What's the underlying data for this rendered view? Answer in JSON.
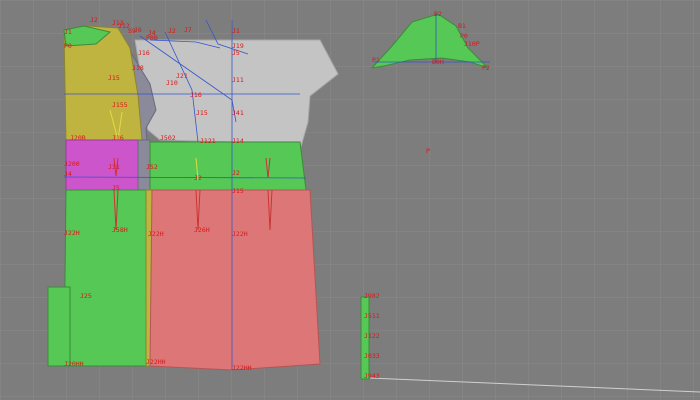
{
  "workspace": {
    "background": "#7d7d7d",
    "grid_color": "#8b8b8b"
  },
  "colors": {
    "green": "#55c855",
    "yellow": "#c0b440",
    "magenta": "#cc55cc",
    "salmon": "#dd7777",
    "light_gray": "#c4c4c4",
    "dark_gray": "#8a8a9a",
    "outline": "#3d8a3d",
    "label": "#d81818",
    "line_blue": "#3355cc"
  },
  "labels": {
    "l1": "J2",
    "l2": "J1",
    "l3": "J13",
    "l4": "J12",
    "l5": "S9",
    "l6": "J6",
    "l7": "J2",
    "l8": "J7",
    "l9": "J4",
    "l10": "J1",
    "l11": "P0B",
    "l12": "P0",
    "l13": "J19",
    "l14": "J16",
    "l15": "J5",
    "l16": "J21",
    "l17": "J18",
    "l18": "J155",
    "l19": "J10",
    "l20": "J11",
    "l21": "J15",
    "l22": "J16",
    "l23": "J15",
    "l24": "J41",
    "l25": "J502",
    "l26": "J20B",
    "l27": "J16",
    "l28": "J121",
    "l29": "J14",
    "l30": "J200",
    "l31": "J31",
    "l32": "J52",
    "l33": "J2",
    "l34": "J4",
    "l35": "J2",
    "l36": "J5",
    "l37": "J15",
    "l38": "J22H",
    "l39": "J58H",
    "l40": "J26H",
    "l41": "J22H",
    "l42": "J22H",
    "l43": "J25",
    "l44": "J20HH",
    "l45": "J22HH",
    "l46": "J22HH",
    "l47": "B2",
    "l48": "B1",
    "l49": "P0",
    "l50": "J10P",
    "l51": "P1",
    "l52": "P2",
    "l53": "B0H",
    "l54": "P",
    "l55": "J982",
    "l56": "J511",
    "l57": "J122",
    "l58": "J033",
    "l59": "J943"
  }
}
